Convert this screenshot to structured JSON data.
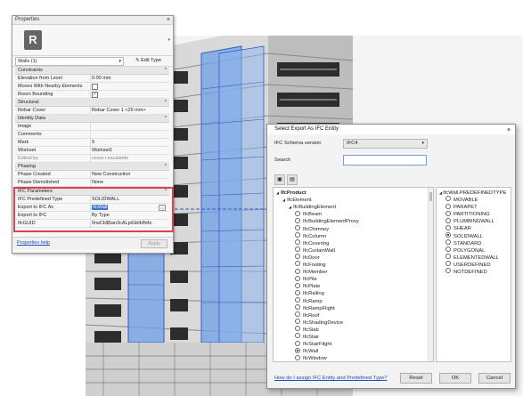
{
  "properties": {
    "title": "Properties",
    "close": "×",
    "type_icon": "R",
    "type_selector_arrow": "▾",
    "filter_label": "Walls (1)",
    "filter_dropdown": "▾",
    "edit_type_label": "Edit Type",
    "sections": {
      "constraints": "Constraints",
      "structural": "Structural",
      "identity": "Identity Data",
      "phasing": "Phasing",
      "ifc": "IFC Parameters"
    },
    "collapse_symbol": "^",
    "rows": {
      "elevation_from_level": {
        "key": "Elevation from Level",
        "value": "0.00 mm"
      },
      "moves_with_nearby": {
        "key": "Moves With Nearby Elements",
        "value": ""
      },
      "room_bounding": {
        "key": "Room Bounding",
        "value": "✓"
      },
      "rebar_cover": {
        "key": "Rebar Cover",
        "value": "Rebar Cover 1 <25 mm>"
      },
      "image": {
        "key": "Image",
        "value": ""
      },
      "comments": {
        "key": "Comments",
        "value": ""
      },
      "mark": {
        "key": "Mark",
        "value": "9"
      },
      "workset": {
        "key": "Workset",
        "value": "Workset1"
      },
      "edited_by": {
        "key": "Edited by",
        "value": "cesar.r.escalante"
      },
      "phase_created": {
        "key": "Phase Created",
        "value": "New Construction"
      },
      "phase_demolished": {
        "key": "Phase Demolished",
        "value": "None"
      },
      "ifc_predefined_type": {
        "key": "IFC Predefined Type",
        "value": "SOLIDWALL"
      },
      "export_to_ifc_as": {
        "key": "Export to IFC As",
        "value": "IfcWall"
      },
      "export_to_ifc": {
        "key": "Export to IFC",
        "value": "By Type"
      },
      "ifc_guid": {
        "key": "IfcGUID",
        "value": "0rwCb$5an3cALpiGbIHN4c"
      }
    },
    "help_link": "Properties help",
    "apply_label": "Apply"
  },
  "dialog": {
    "title": "Select Export As IFC Entity",
    "close": "×",
    "schema_label": "IFC Schema version",
    "schema_value": "IFC4",
    "schema_dropdown": "▾",
    "search_label": "Search",
    "search_value": "",
    "tree": [
      {
        "label": "IfcProduct",
        "level": 0,
        "expander": "◢",
        "bold": true
      },
      {
        "label": "IfcElement",
        "level": 1,
        "expander": "◢"
      },
      {
        "label": "IfcBuildingElement",
        "level": 2,
        "expander": "◢"
      },
      {
        "label": "IfcBeam",
        "level": 3,
        "radio": true
      },
      {
        "label": "IfcBuildingElementProxy",
        "level": 3,
        "radio": true
      },
      {
        "label": "IfcChimney",
        "level": 3,
        "radio": true
      },
      {
        "label": "IfcColumn",
        "level": 3,
        "radio": true
      },
      {
        "label": "IfcCovering",
        "level": 3,
        "radio": true
      },
      {
        "label": "IfcCurtainWall",
        "level": 3,
        "radio": true
      },
      {
        "label": "IfcDoor",
        "level": 3,
        "radio": true
      },
      {
        "label": "IfcFooting",
        "level": 3,
        "radio": true
      },
      {
        "label": "IfcMember",
        "level": 3,
        "radio": true
      },
      {
        "label": "IfcPile",
        "level": 3,
        "radio": true
      },
      {
        "label": "IfcPlate",
        "level": 3,
        "radio": true
      },
      {
        "label": "IfcRailing",
        "level": 3,
        "radio": true
      },
      {
        "label": "IfcRamp",
        "level": 3,
        "radio": true
      },
      {
        "label": "IfcRampFlight",
        "level": 3,
        "radio": true
      },
      {
        "label": "IfcRoof",
        "level": 3,
        "radio": true
      },
      {
        "label": "IfcShadingDevice",
        "level": 3,
        "radio": true
      },
      {
        "label": "IfcSlab",
        "level": 3,
        "radio": true
      },
      {
        "label": "IfcStair",
        "level": 3,
        "radio": true
      },
      {
        "label": "IfcStairFlight",
        "level": 3,
        "radio": true
      },
      {
        "label": "IfcWall",
        "level": 3,
        "radio": true,
        "selected": true
      },
      {
        "label": "IfcWindow",
        "level": 3,
        "radio": true
      }
    ],
    "predefined_header": "IfcWall.PREDEFINEDTYPE",
    "predefined_expander": "◢",
    "predefined_types": [
      {
        "label": "MOVABLE",
        "selected": false
      },
      {
        "label": "PARAPET",
        "selected": false
      },
      {
        "label": "PARTITIONING",
        "selected": false
      },
      {
        "label": "PLUMBINGWALL",
        "selected": false
      },
      {
        "label": "SHEAR",
        "selected": false
      },
      {
        "label": "SOLIDWALL",
        "selected": true
      },
      {
        "label": "STANDARD",
        "selected": false
      },
      {
        "label": "POLYGONAL",
        "selected": false
      },
      {
        "label": "ELEMENTEDWALL",
        "selected": false
      },
      {
        "label": "USERDEFINED",
        "selected": false
      },
      {
        "label": "NOTDEFINED",
        "selected": false
      }
    ],
    "help_link": "How do I assign IFC Entity and Predefined Type?",
    "buttons": {
      "reset": "Reset",
      "ok": "OK",
      "cancel": "Cancel"
    }
  }
}
